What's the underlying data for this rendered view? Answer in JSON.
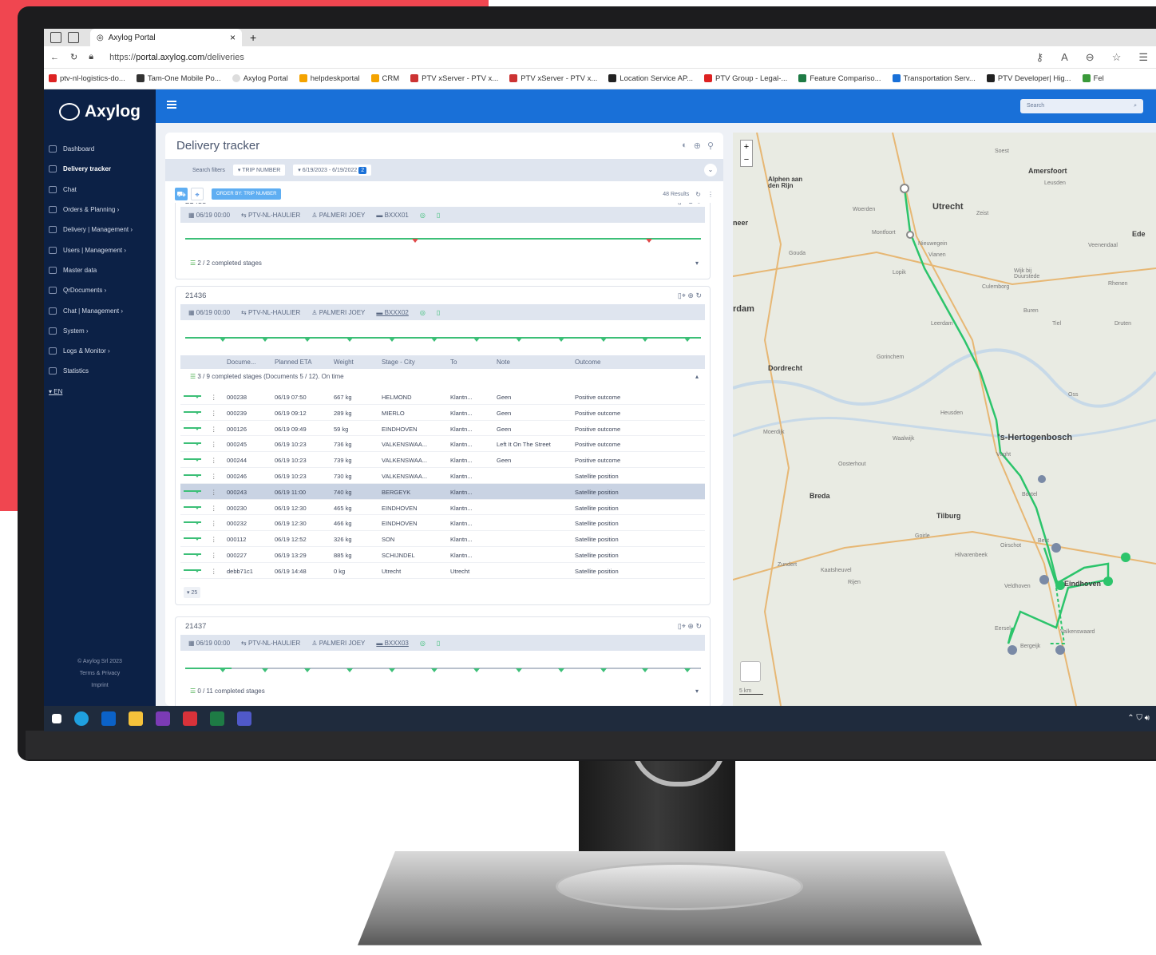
{
  "browser": {
    "tab_title": "Axylog Portal",
    "url_prefix": "https://",
    "url_host": "portal.axylog.com",
    "url_path": "/deliveries",
    "bookmarks": [
      "ptv-nl-logistics-do...",
      "Tam-One Mobile Po...",
      "Axylog Portal",
      "helpdeskportal",
      "CRM",
      "PTV xServer - PTV x...",
      "PTV xServer - PTV x...",
      "Location Service AP...",
      "PTV Group - Legal-...",
      "Feature Compariso...",
      "Transportation Serv...",
      "PTV Developer| Hig...",
      "Fel"
    ]
  },
  "sidebar": {
    "brand": "Axylog",
    "items": [
      {
        "label": "Dashboard"
      },
      {
        "label": "Delivery tracker"
      },
      {
        "label": "Chat"
      },
      {
        "label": "Orders & Planning  ›"
      },
      {
        "label": "Delivery | Management  ›"
      },
      {
        "label": "Users | Management  ›"
      },
      {
        "label": "Master data"
      },
      {
        "label": "QrDocuments  ›"
      },
      {
        "label": "Chat | Management  ›"
      },
      {
        "label": "System  ›"
      },
      {
        "label": "Logs & Monitor  ›"
      },
      {
        "label": "Statistics"
      },
      {
        "label": "▾  EN"
      }
    ],
    "footer": [
      "© Axylog Srl 2023",
      "Terms & Privacy",
      "Imprint"
    ]
  },
  "topbar": {
    "search_placeholder": "Search"
  },
  "tracker": {
    "title": "Delivery tracker",
    "filters_label": "Search filters",
    "filter_trip": "▾  TRIP NUMBER",
    "filter_date": "▾  6/19/2023 - 6/19/2022",
    "filter_count": "2",
    "order_btn": "ORDER BY: TRIP NUMBER",
    "results": "48 Results",
    "page_size": "▾ 25"
  },
  "cards": [
    {
      "id": "21435",
      "date": "▦ 06/19 00:00",
      "carrier": "⇆ PTV-NL-HAULIER",
      "driver": "♙ PALMERI JOEY",
      "vehicle": "▬ BXXX01",
      "stages": "2 / 2 completed stages"
    },
    {
      "id": "21436",
      "date": "▦ 06/19 00:00",
      "carrier": "⇆ PTV-NL-HAULIER",
      "driver": "♙ PALMERI JOEY",
      "vehicle": "▬ BXXX02",
      "stages": "3 / 9 completed stages (Documents 5 / 12). On time"
    },
    {
      "id": "21437",
      "date": "▦ 06/19 00:00",
      "carrier": "⇆ PTV-NL-HAULIER",
      "driver": "♙ PALMERI JOEY",
      "vehicle": "▬ BXXX03",
      "stages": "0 / 11 completed stages"
    }
  ],
  "table": {
    "headers": [
      "Docume...",
      "Planned ETA",
      "Weight",
      "Stage - City",
      "To",
      "Note",
      "Outcome"
    ],
    "rows": [
      [
        "000238",
        "06/19 07:50",
        "667 kg",
        "HELMOND",
        "Klantn...",
        "Geen",
        "Positive outcome"
      ],
      [
        "000239",
        "06/19 09:12",
        "289 kg",
        "MIERLO",
        "Klantn...",
        "Geen",
        "Positive outcome"
      ],
      [
        "000126",
        "06/19 09:49",
        "59 kg",
        "EINDHOVEN",
        "Klantn...",
        "Geen",
        "Positive outcome"
      ],
      [
        "000245",
        "06/19 10:23",
        "736 kg",
        "VALKENSWAA...",
        "Klantn...",
        "Left It On The Street",
        "Positive outcome"
      ],
      [
        "000244",
        "06/19 10:23",
        "739 kg",
        "VALKENSWAA...",
        "Klantn...",
        "Geen",
        "Positive outcome"
      ],
      [
        "000246",
        "06/19 10:23",
        "730 kg",
        "VALKENSWAA...",
        "Klantn...",
        "",
        "Satellite position"
      ],
      [
        "000243",
        "06/19 11:00",
        "740 kg",
        "BERGEYK",
        "Klantn...",
        "",
        "Satellite position"
      ],
      [
        "000230",
        "06/19 12:30",
        "465 kg",
        "EINDHOVEN",
        "Klantn...",
        "",
        "Satellite position"
      ],
      [
        "000232",
        "06/19 12:30",
        "466 kg",
        "EINDHOVEN",
        "Klantn...",
        "",
        "Satellite position"
      ],
      [
        "000112",
        "06/19 12:52",
        "326 kg",
        "SON",
        "Klantn...",
        "",
        "Satellite position"
      ],
      [
        "000227",
        "06/19 13:29",
        "885 kg",
        "SCHIJNDEL",
        "Klantn...",
        "",
        "Satellite position"
      ],
      [
        "debb71c1",
        "06/19 14:48",
        "0 kg",
        "Utrecht",
        "Utrecht",
        "",
        "Satellite position"
      ]
    ]
  },
  "map": {
    "places": [
      "Utrecht",
      "Amersfoort",
      "Alphen aan den Rijn",
      "'s-Hertogenbosch",
      "Dordrecht",
      "Breda",
      "Tilburg",
      "Eindhoven",
      "Ede",
      "rdam",
      "neer"
    ],
    "minor": [
      "Woerden",
      "Nieuwegein",
      "Culemborg",
      "Gouda",
      "Gorinchem",
      "Heusden",
      "Vught",
      "Oss",
      "Waalwijk",
      "Best",
      "Boxtel",
      "Oirschot",
      "Veldhoven",
      "Valkenswaard",
      "Bergeijk",
      "Eersel",
      "Moerdijk",
      "Oosterhout",
      "Zundert",
      "Hilvarenbeek",
      "Goirle",
      "Rijen",
      "Kaatsheuvel",
      "Zeist",
      "Soest",
      "Leusden",
      "Veenendaal",
      "Rhenen",
      "Tiel",
      "Druten",
      "Buren",
      "Leerdam",
      "Wijk bij Duurstede",
      "Montfoort",
      "Lopik",
      "Vianen"
    ],
    "scale": "5 km"
  }
}
